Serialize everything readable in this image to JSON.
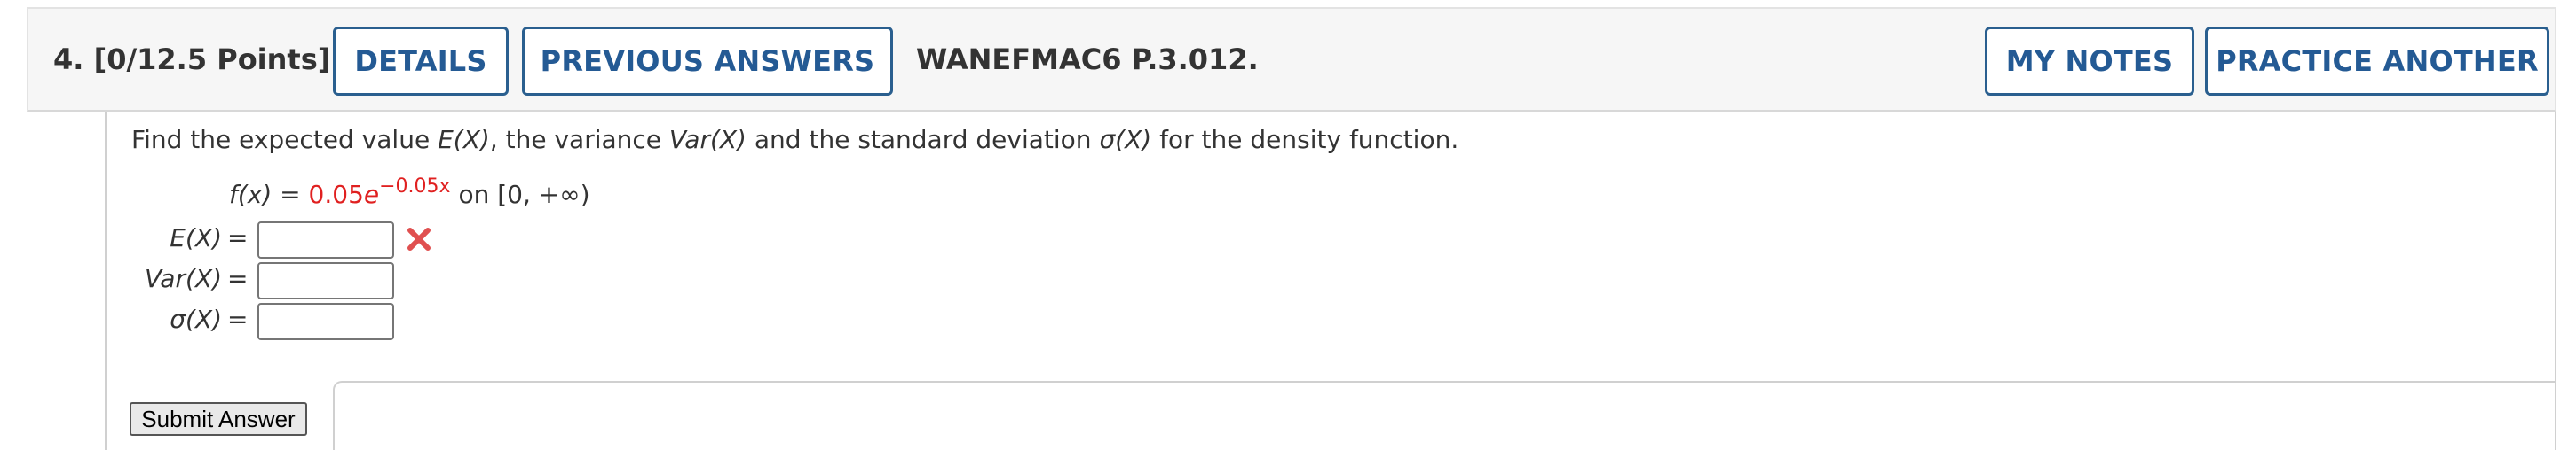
{
  "header": {
    "question_label": "4.  [0/12.5 Points]",
    "details_label": "DETAILS",
    "previous_answers_label": "PREVIOUS ANSWERS",
    "problem_code": "WANEFMAC6 P.3.012.",
    "my_notes_label": "MY NOTES",
    "practice_another_label": "PRACTICE ANOTHER"
  },
  "question": {
    "prompt_parts": [
      "Find the expected value ",
      "E(X)",
      ",  the variance ",
      "Var(X)",
      " and the standard deviation ",
      "σ(X)",
      " for the density function."
    ],
    "formula": {
      "lhs": "f(x) = ",
      "coefficient": "0.05",
      "base": "e",
      "exponent": "−0.05x",
      "domain_text": " on  [0, +∞)"
    }
  },
  "answers": [
    {
      "label": "E(X)",
      "equals": "=",
      "value": "",
      "status": "incorrect"
    },
    {
      "label": "Var(X)",
      "equals": "=",
      "value": "",
      "status": ""
    },
    {
      "label": "σ(X)",
      "equals": "=",
      "value": "",
      "status": ""
    }
  ],
  "submit_label": "Submit Answer",
  "colors": {
    "accent": "#245a94",
    "incorrect": "#e05050",
    "highlight": "#e02020"
  },
  "icons": {
    "incorrect_mark": "x-icon"
  }
}
